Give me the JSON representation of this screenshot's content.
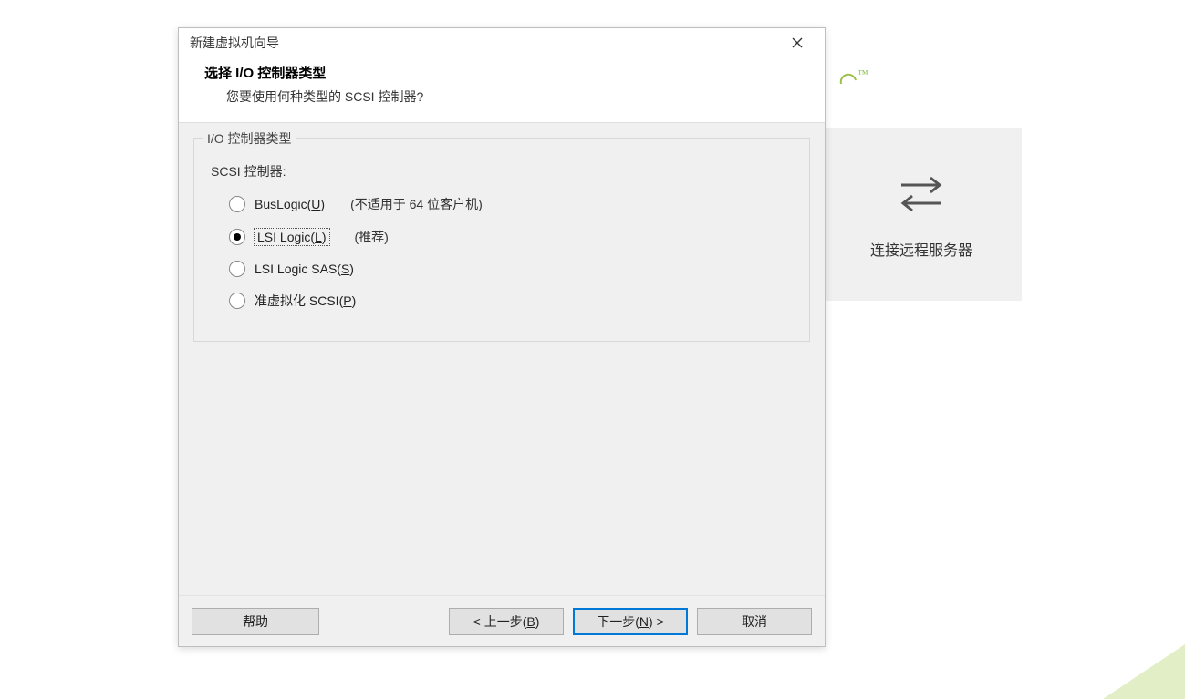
{
  "background": {
    "tile_label": "连接远程服务器",
    "trademark": "™"
  },
  "dialog": {
    "title": "新建虚拟机向导",
    "header_title": "选择 I/O 控制器类型",
    "header_subtitle": "您要使用何种类型的 SCSI 控制器?",
    "fieldset_legend": "I/O 控制器类型",
    "scsi_label": "SCSI 控制器:",
    "options": [
      {
        "label_pre": "BusLogic(",
        "mnemonic": "U",
        "label_post": ")",
        "hint": "(不适用于 64 位客户机)",
        "checked": false,
        "focused": false
      },
      {
        "label_pre": "LSI Logic(",
        "mnemonic": "L",
        "label_post": ")",
        "hint": "(推荐)",
        "checked": true,
        "focused": true
      },
      {
        "label_pre": "LSI Logic SAS(",
        "mnemonic": "S",
        "label_post": ")",
        "hint": "",
        "checked": false,
        "focused": false
      },
      {
        "label_pre": "准虚拟化 SCSI(",
        "mnemonic": "P",
        "label_post": ")",
        "hint": "",
        "checked": false,
        "focused": false
      }
    ],
    "buttons": {
      "help": "帮助",
      "back_pre": "< 上一步(",
      "back_mn": "B",
      "back_post": ")",
      "next_pre": "下一步(",
      "next_mn": "N",
      "next_post": ") >",
      "cancel": "取消"
    }
  }
}
